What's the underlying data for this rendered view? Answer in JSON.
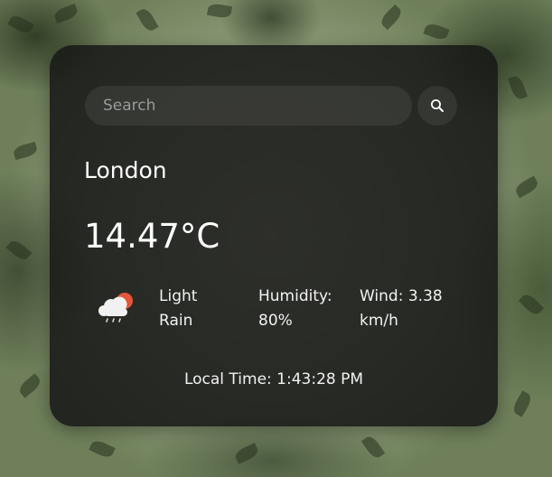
{
  "search": {
    "placeholder": "Search",
    "value": ""
  },
  "weather": {
    "city": "London",
    "temperature": "14.47°C",
    "description_line1": "Light",
    "description_line2": "Rain",
    "humidity_label": "Humidity:",
    "humidity_value": "80%",
    "wind_label": "Wind: 3.38",
    "wind_unit": "km/h",
    "local_time": "Local Time: 1:43:28 PM"
  },
  "icons": {
    "search": "search-icon",
    "weather": "cloud-sun-rain-icon"
  },
  "colors": {
    "card_background": "#161616",
    "text": "#ffffff",
    "sun": "#e4553a"
  }
}
